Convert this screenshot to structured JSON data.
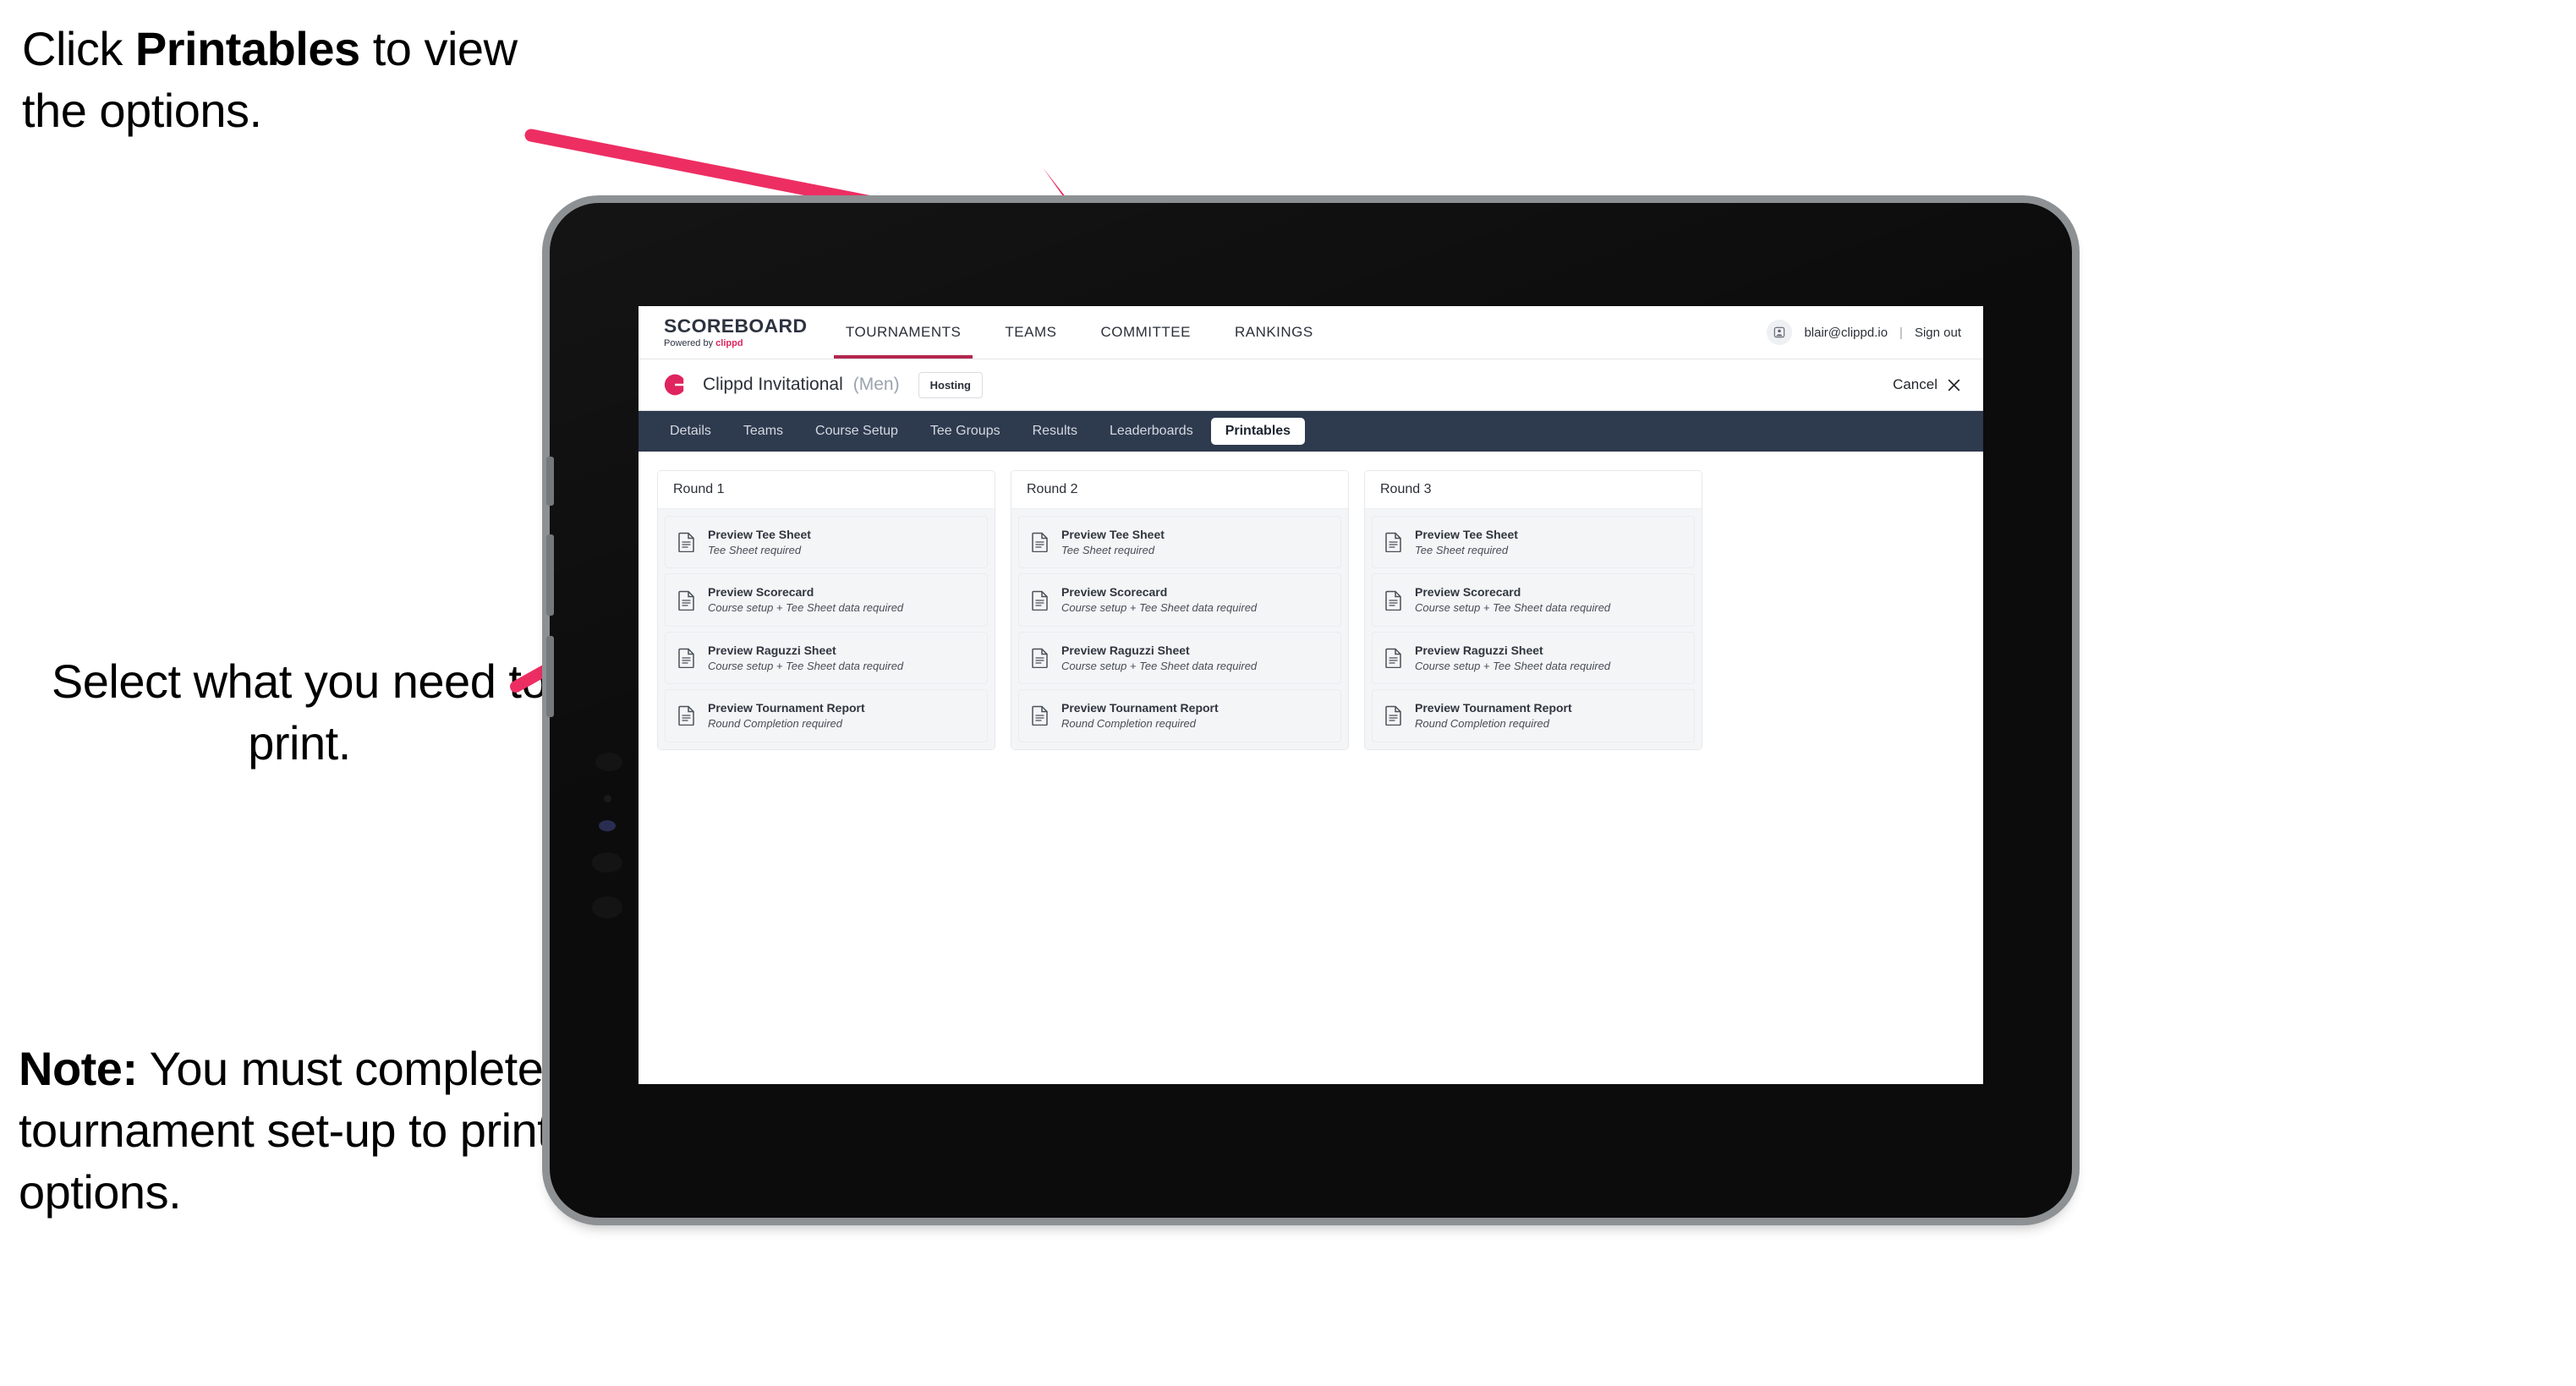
{
  "annotations": {
    "top": {
      "pre": "Click ",
      "strong": "Printables",
      "post": " to view the options."
    },
    "middle": "Select what you need to print.",
    "note": {
      "strong": "Note:",
      "text": " You must complete the tournament set-up to print all the options."
    }
  },
  "colors": {
    "arrow_pink": "#ED2E63",
    "brand_accent": "#E0245E",
    "tab_bar": "#2E3A4E",
    "tournaments_underline": "#B3274E",
    "tablet_body": "#0C0C0C",
    "tablet_bezel": "#8D9194"
  },
  "app": {
    "brand": {
      "title": "SCOREBOARD",
      "powered_prefix": "Powered by ",
      "powered_accent": "clippd"
    },
    "top_nav": [
      {
        "label": "TOURNAMENTS",
        "active": true
      },
      {
        "label": "TEAMS",
        "active": false
      },
      {
        "label": "COMMITTEE",
        "active": false
      },
      {
        "label": "RANKINGS",
        "active": false
      }
    ],
    "account": {
      "avatar_icon": "user-avatar-icon",
      "email": "blair@clippd.io",
      "separator": "|",
      "sign_out": "Sign out"
    },
    "tournament": {
      "logo_icon": "clippd-c-logo-icon",
      "name": "Clippd Invitational",
      "gender": "(Men)",
      "hosting_badge": "Hosting",
      "cancel_label": "Cancel",
      "cancel_icon": "close-x-icon"
    },
    "tabs": [
      {
        "label": "Details",
        "active": false
      },
      {
        "label": "Teams",
        "active": false
      },
      {
        "label": "Course Setup",
        "active": false
      },
      {
        "label": "Tee Groups",
        "active": false
      },
      {
        "label": "Results",
        "active": false
      },
      {
        "label": "Leaderboards",
        "active": false
      },
      {
        "label": "Printables",
        "active": true
      }
    ],
    "printables": {
      "rounds": [
        {
          "header": "Round 1",
          "items": [
            {
              "title": "Preview Tee Sheet",
              "requirement": "Tee Sheet required",
              "icon": "document-icon"
            },
            {
              "title": "Preview Scorecard",
              "requirement": "Course setup + Tee Sheet data required",
              "icon": "document-icon"
            },
            {
              "title": "Preview Raguzzi Sheet",
              "requirement": "Course setup + Tee Sheet data required",
              "icon": "document-icon"
            },
            {
              "title": "Preview Tournament Report",
              "requirement": "Round Completion required",
              "icon": "document-icon"
            }
          ]
        },
        {
          "header": "Round 2",
          "items": [
            {
              "title": "Preview Tee Sheet",
              "requirement": "Tee Sheet required",
              "icon": "document-icon"
            },
            {
              "title": "Preview Scorecard",
              "requirement": "Course setup + Tee Sheet data required",
              "icon": "document-icon"
            },
            {
              "title": "Preview Raguzzi Sheet",
              "requirement": "Course setup + Tee Sheet data required",
              "icon": "document-icon"
            },
            {
              "title": "Preview Tournament Report",
              "requirement": "Round Completion required",
              "icon": "document-icon"
            }
          ]
        },
        {
          "header": "Round 3",
          "items": [
            {
              "title": "Preview Tee Sheet",
              "requirement": "Tee Sheet required",
              "icon": "document-icon"
            },
            {
              "title": "Preview Scorecard",
              "requirement": "Course setup + Tee Sheet data required",
              "icon": "document-icon"
            },
            {
              "title": "Preview Raguzzi Sheet",
              "requirement": "Course setup + Tee Sheet data required",
              "icon": "document-icon"
            },
            {
              "title": "Preview Tournament Report",
              "requirement": "Round Completion required",
              "icon": "document-icon"
            }
          ]
        }
      ]
    }
  }
}
